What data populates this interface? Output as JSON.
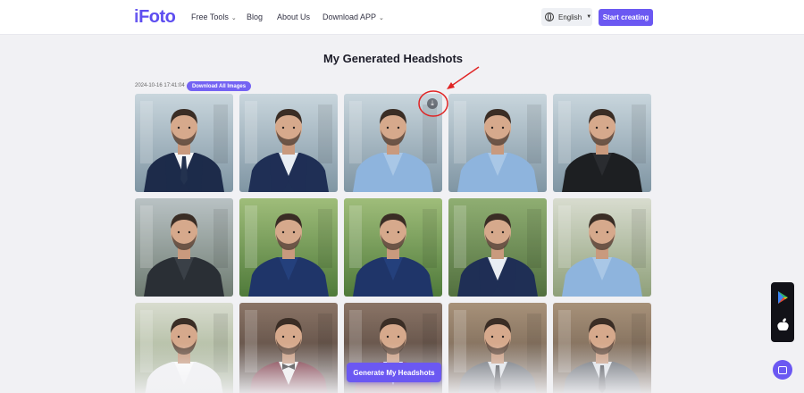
{
  "nav": {
    "logo_i": "i",
    "logo_rest": "Foto",
    "items": [
      {
        "label": "Free Tools",
        "dropdown": true
      },
      {
        "label": "Blog",
        "dropdown": false
      },
      {
        "label": "About Us",
        "dropdown": false
      },
      {
        "label": "Download APP",
        "dropdown": true
      }
    ],
    "language": "English",
    "cta": "Start creating"
  },
  "main": {
    "title": "My Generated Headshots",
    "timestamp": "2024-10-16 17:41:04",
    "download_all": "Download All Images",
    "generate_button": "Generate My Headshots"
  },
  "headshots": [
    {
      "scene": "office",
      "outfit": "navy-suit-tie"
    },
    {
      "scene": "office",
      "outfit": "navy-suit-open-collar"
    },
    {
      "scene": "office",
      "outfit": "light-blue-shirt"
    },
    {
      "scene": "office",
      "outfit": "light-blue-shirt"
    },
    {
      "scene": "office",
      "outfit": "black-hoodie"
    },
    {
      "scene": "outdoor",
      "outfit": "dark-hoodie"
    },
    {
      "scene": "park",
      "outfit": "navy-polo"
    },
    {
      "scene": "park",
      "outfit": "navy-polo"
    },
    {
      "scene": "garden",
      "outfit": "navy-suit-open-collar"
    },
    {
      "scene": "house",
      "outfit": "light-blue-shirt"
    },
    {
      "scene": "house",
      "outfit": "white-shirt"
    },
    {
      "scene": "event",
      "outfit": "burgundy-tuxedo"
    },
    {
      "scene": "event",
      "outfit": "burgundy-tuxedo"
    },
    {
      "scene": "interior",
      "outfit": "grey-suit-tie"
    },
    {
      "scene": "interior",
      "outfit": "grey-suit-tie"
    }
  ],
  "colors": {
    "accent": "#6b58f2",
    "page_bg": "#f1f1f4",
    "annotation": "#e02424"
  },
  "icons": {
    "download": "download-icon",
    "play_store": "google-play-icon",
    "app_store": "apple-icon",
    "chat": "chat-icon"
  }
}
